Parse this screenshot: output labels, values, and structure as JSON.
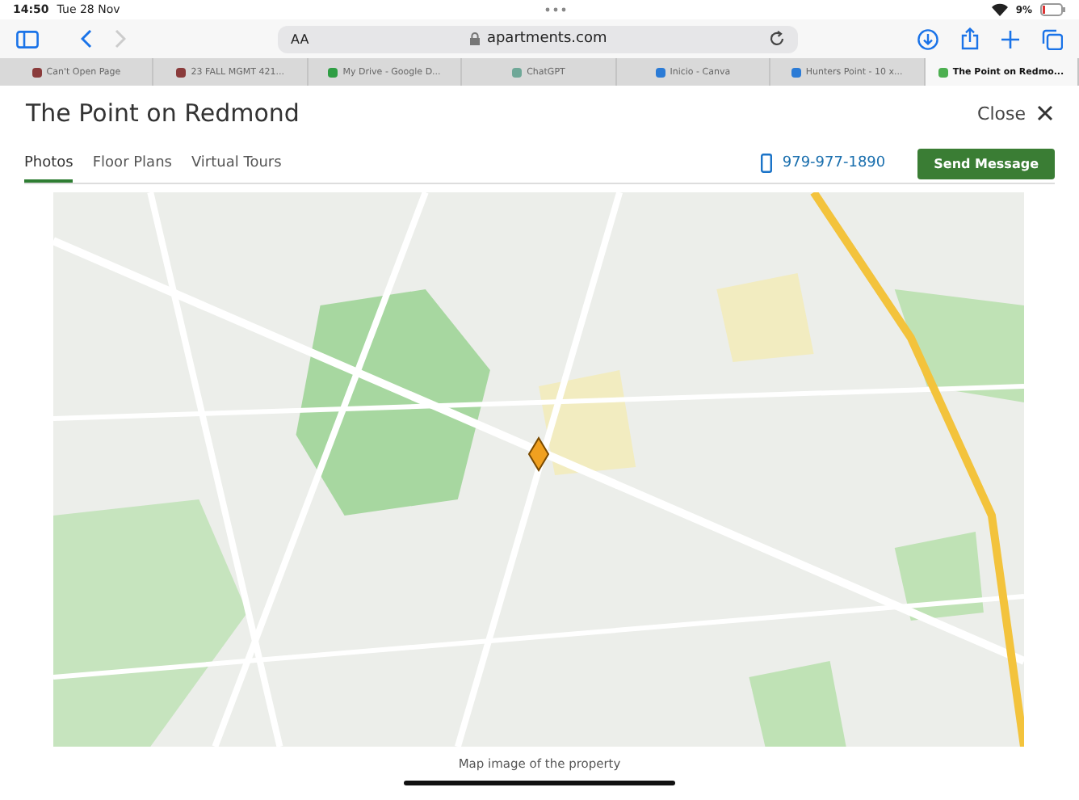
{
  "status_bar": {
    "time": "14:50",
    "date": "Tue 28 Nov",
    "battery": "9%"
  },
  "toolbar": {
    "text_size": "AA",
    "address": "apartments.com"
  },
  "browser_tabs": [
    {
      "title": "Can't Open Page",
      "color": "#8a3b3b",
      "selected": false
    },
    {
      "title": "23 FALL MGMT 421...",
      "color": "#8a3b3b",
      "selected": false
    },
    {
      "title": "My Drive - Google D...",
      "color": "#2f9e44",
      "selected": false
    },
    {
      "title": "ChatGPT",
      "color": "#6fa898",
      "selected": false
    },
    {
      "title": "Inicio - Canva",
      "color": "#2b7bd6",
      "selected": false
    },
    {
      "title": "Hunters Point - 10 x...",
      "color": "#2b7bd6",
      "selected": false
    },
    {
      "title": "The Point on Redmo...",
      "color": "#4caf50",
      "selected": true
    }
  ],
  "header": {
    "title": "The Point on Redmond",
    "close": "Close"
  },
  "page_tabs": [
    {
      "label": "Photos",
      "selected": true
    },
    {
      "label": "Floor Plans",
      "selected": false
    },
    {
      "label": "Virtual Tours",
      "selected": false
    }
  ],
  "contact": {
    "phone": "979-977-1890",
    "button": "Send Message"
  },
  "caption": "Map image of the property"
}
